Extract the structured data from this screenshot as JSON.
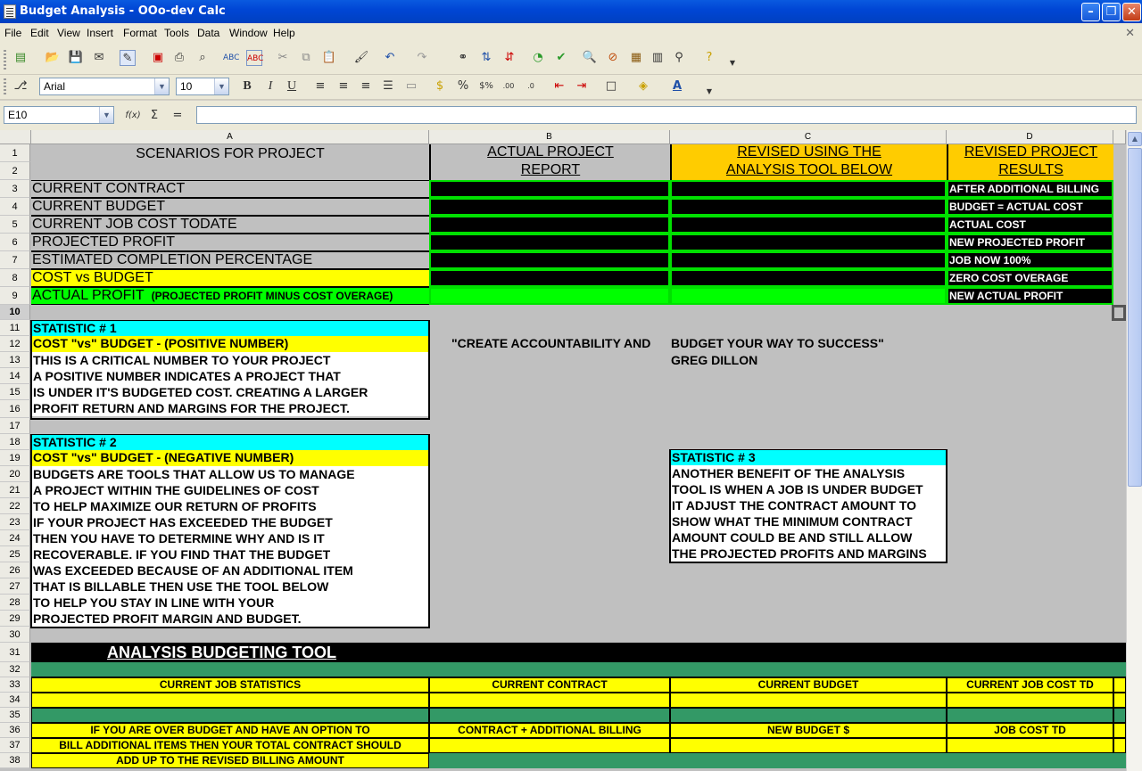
{
  "window": {
    "title": "Budget Analysis - OOo-dev Calc",
    "minimize": "0",
    "restore": "1",
    "close": "r"
  },
  "menu": [
    "File",
    "Edit",
    "View",
    "Insert",
    "Format",
    "Tools",
    "Data",
    "Window",
    "Help"
  ],
  "toolbar": {
    "font_name": "Arial",
    "font_size": "10",
    "bold": "B",
    "italic": "I",
    "underline": "U"
  },
  "formula_bar": {
    "name_box": "E10",
    "function_icon": "f(x)",
    "sum": "Σ",
    "equals": "=",
    "value": ""
  },
  "columns": [
    "A",
    "B",
    "C",
    "D"
  ],
  "rows": [
    "1",
    "2",
    "3",
    "4",
    "5",
    "6",
    "7",
    "8",
    "9",
    "10",
    "11",
    "12",
    "13",
    "14",
    "15",
    "16",
    "17",
    "18",
    "19",
    "20",
    "21",
    "22",
    "23",
    "24",
    "25",
    "26",
    "27",
    "28",
    "29",
    "30",
    "31",
    "32",
    "33",
    "34",
    "35",
    "36",
    "37",
    "38"
  ],
  "selected_row": "10",
  "colors": {
    "yellow": "#ffff00",
    "gold": "#ffcc00",
    "cyan": "#00ffff",
    "green": "#00ff00",
    "dark_green": "#339966",
    "black": "#000000",
    "grey": "#c0c0c0"
  },
  "sheet": {
    "a1": "SCENARIOS FOR PROJECT",
    "b1": "ACTUAL PROJECT",
    "b2": "REPORT",
    "c1": "REVISED USING THE",
    "c2": "ANALYSIS TOOL BELOW",
    "d1": "REVISED PROJECT",
    "d2": "RESULTS",
    "scenarios": [
      {
        "label": "CURRENT CONTRACT",
        "result": "AFTER ADDITIONAL BILLING"
      },
      {
        "label": "CURRENT BUDGET",
        "result": "BUDGET = ACTUAL COST"
      },
      {
        "label": "CURRENT JOB COST TODATE",
        "result": "ACTUAL COST"
      },
      {
        "label": "PROJECTED PROFIT",
        "result": "NEW PROJECTED PROFIT"
      },
      {
        "label": "ESTIMATED COMPLETION PERCENTAGE",
        "result": "JOB NOW 100%"
      },
      {
        "label": "COST vs BUDGET",
        "result": "ZERO COST OVERAGE"
      },
      {
        "label": "ACTUAL PROFIT",
        "sub": "(PROJECTED PROFIT MINUS COST OVERAGE)",
        "result": "NEW ACTUAL PROFIT"
      }
    ],
    "stat1": {
      "title": "STATISTIC # 1",
      "subtitle": "COST \"vs\" BUDGET - (POSITIVE NUMBER)",
      "lines": [
        "THIS IS A CRITICAL NUMBER TO YOUR PROJECT",
        "A POSITIVE NUMBER INDICATES A PROJECT THAT",
        "IS UNDER IT'S BUDGETED COST.  CREATING A LARGER",
        "PROFIT RETURN AND MARGINS FOR THE PROJECT."
      ]
    },
    "quote": {
      "line1a": "\"CREATE ACCOUNTABILITY AND",
      "line1b": "BUDGET YOUR WAY TO SUCCESS\"",
      "author": "GREG DILLON"
    },
    "stat2": {
      "title": "STATISTIC # 2",
      "subtitle": "COST \"vs\" BUDGET - (NEGATIVE NUMBER)",
      "lines": [
        "BUDGETS ARE TOOLS THAT ALLOW US TO MANAGE",
        "A PROJECT WITHIN THE GUIDELINES OF COST",
        "TO HELP MAXIMIZE OUR RETURN OF PROFITS",
        "IF YOUR PROJECT HAS EXCEEDED THE BUDGET",
        "THEN YOU HAVE TO DETERMINE WHY AND IS IT",
        "RECOVERABLE.  IF YOU FIND THAT THE BUDGET",
        "WAS EXCEEDED BECAUSE OF AN ADDITIONAL ITEM",
        "THAT IS BILLABLE THEN USE THE TOOL BELOW",
        "TO HELP YOU STAY IN LINE WITH YOUR",
        "PROJECTED PROFIT MARGIN AND BUDGET."
      ]
    },
    "stat3": {
      "title": "STATISTIC # 3",
      "lines": [
        "ANOTHER BENEFIT OF THE ANALYSIS",
        "TOOL IS WHEN A JOB IS UNDER BUDGET",
        "IT ADJUST THE CONTRACT AMOUNT TO",
        "SHOW WHAT THE MINIMUM CONTRACT",
        "AMOUNT COULD BE AND STILL ALLOW",
        "THE PROJECTED PROFITS AND MARGINS"
      ]
    },
    "tool_title": "ANALYSIS BUDGETING TOOL",
    "row33": [
      "CURRENT JOB STATISTICS",
      "CURRENT CONTRACT",
      "CURRENT BUDGET",
      "CURRENT JOB COST TD"
    ],
    "row36": [
      "IF YOU ARE OVER BUDGET AND HAVE AN OPTION TO",
      "CONTRACT + ADDITIONAL BILLING",
      "NEW BUDGET $",
      "JOB COST TD"
    ],
    "row37": "BILL ADDITIONAL ITEMS THEN YOUR TOTAL CONTRACT SHOULD",
    "row38": "ADD UP TO THE REVISED BILLING AMOUNT"
  }
}
